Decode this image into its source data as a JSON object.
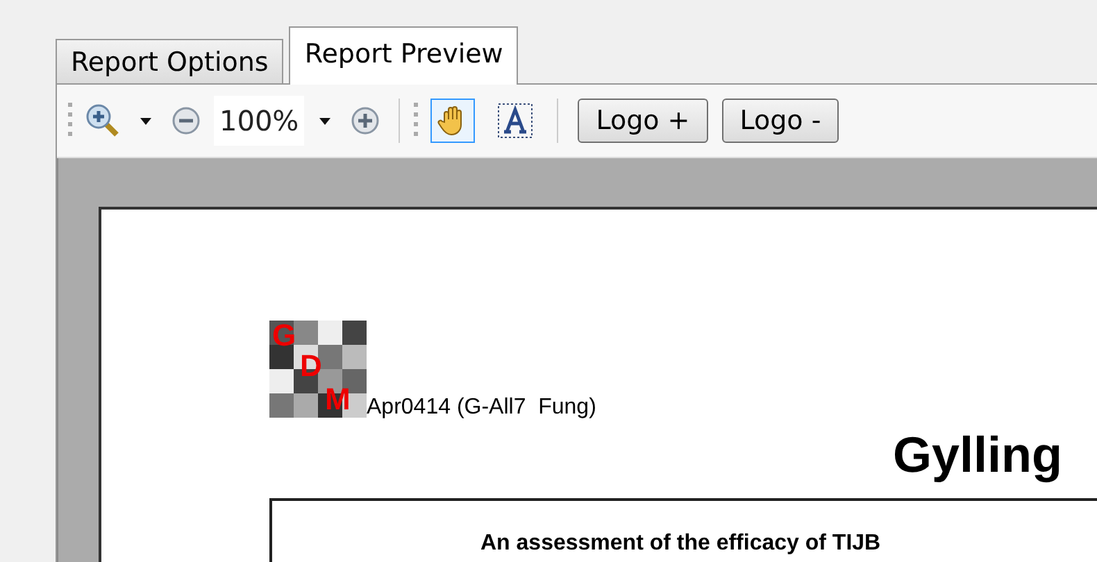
{
  "tabs": [
    {
      "label": "Report Options",
      "selected": false
    },
    {
      "label": "Report Preview",
      "selected": true
    }
  ],
  "toolbar": {
    "zoom": "100%",
    "tools": [
      {
        "kind": "hand",
        "selected": true
      },
      {
        "kind": "text",
        "selected": false
      }
    ],
    "buttons": [
      "Logo +",
      "Logo -"
    ]
  },
  "page": {
    "logo_letters": [
      "G",
      "D",
      "M"
    ],
    "trial_id": "Apr0414 (G-All7  Fung)",
    "title": "Gylling",
    "box_text": "An assessment of the efficacy of TIJB"
  }
}
